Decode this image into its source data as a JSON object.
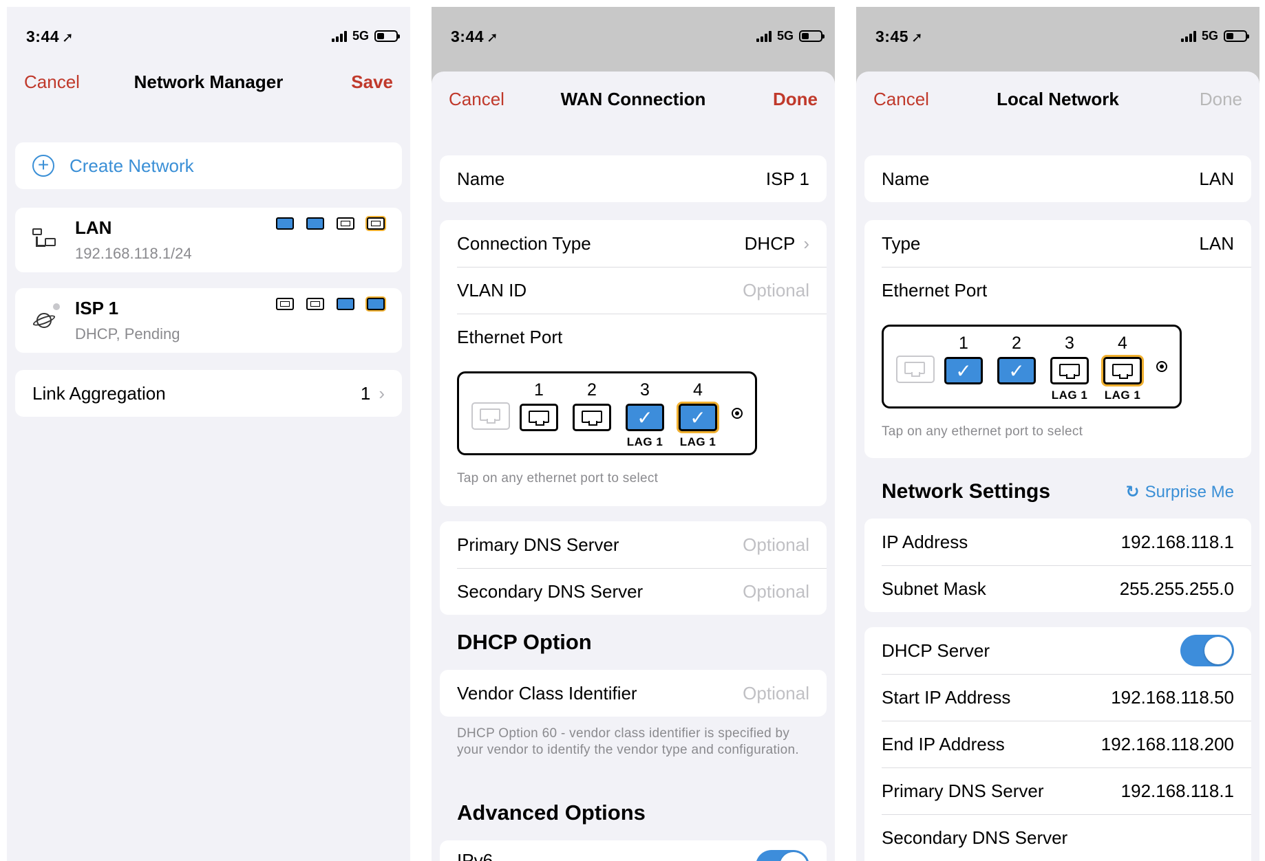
{
  "screens": {
    "manager": {
      "time": "3:44",
      "network": "5G",
      "cancel": "Cancel",
      "title": "Network Manager",
      "save": "Save",
      "create": "Create Network",
      "lan": {
        "name": "LAN",
        "sub": "192.168.118.1/24"
      },
      "isp": {
        "name": "ISP 1",
        "sub": "DHCP, Pending"
      },
      "link_agg": {
        "label": "Link Aggregation",
        "value": "1"
      }
    },
    "wan": {
      "time": "3:44",
      "network": "5G",
      "cancel": "Cancel",
      "title": "WAN Connection",
      "done": "Done",
      "name_label": "Name",
      "name_value": "ISP 1",
      "conn_type_label": "Connection Type",
      "conn_type_value": "DHCP",
      "vlan_label": "VLAN ID",
      "vlan_placeholder": "Optional",
      "eth_label": "Ethernet Port",
      "ports": [
        "1",
        "2",
        "3",
        "4"
      ],
      "lag": "LAG 1",
      "eth_hint": "Tap on any ethernet port to select",
      "dns1_label": "Primary DNS Server",
      "dns1_placeholder": "Optional",
      "dns2_label": "Secondary DNS Server",
      "dns2_placeholder": "Optional",
      "dhcp_option_title": "DHCP Option",
      "vendor_label": "Vendor Class Identifier",
      "vendor_placeholder": "Optional",
      "vendor_hint": "DHCP Option 60 - vendor class identifier is specified by your vendor to identify the vendor type and configuration.",
      "advanced_title": "Advanced Options",
      "advanced_first": "IPv6"
    },
    "local": {
      "time": "3:45",
      "network": "5G",
      "cancel": "Cancel",
      "title": "Local Network",
      "done": "Done",
      "name_label": "Name",
      "name_value": "LAN",
      "type_label": "Type",
      "type_value": "LAN",
      "eth_label": "Ethernet Port",
      "ports": [
        "1",
        "2",
        "3",
        "4"
      ],
      "lag": "LAG 1",
      "eth_hint": "Tap on any ethernet port to select",
      "net_settings_title": "Network Settings",
      "surprise": "Surprise Me",
      "ip_label": "IP Address",
      "ip_value": "192.168.118.1",
      "mask_label": "Subnet Mask",
      "mask_value": "255.255.255.0",
      "dhcp_label": "DHCP Server",
      "start_label": "Start IP Address",
      "start_value": "192.168.118.50",
      "end_label": "End IP Address",
      "end_value": "192.168.118.200",
      "pdns_label": "Primary DNS Server",
      "pdns_value": "192.168.118.1",
      "sdns_label": "Secondary DNS Server"
    }
  },
  "colors": {
    "accent_red": "#c0392b",
    "accent_blue": "#3d8ddb",
    "lag_outline": "#f0b030",
    "link_blue": "#3a8fd6"
  }
}
